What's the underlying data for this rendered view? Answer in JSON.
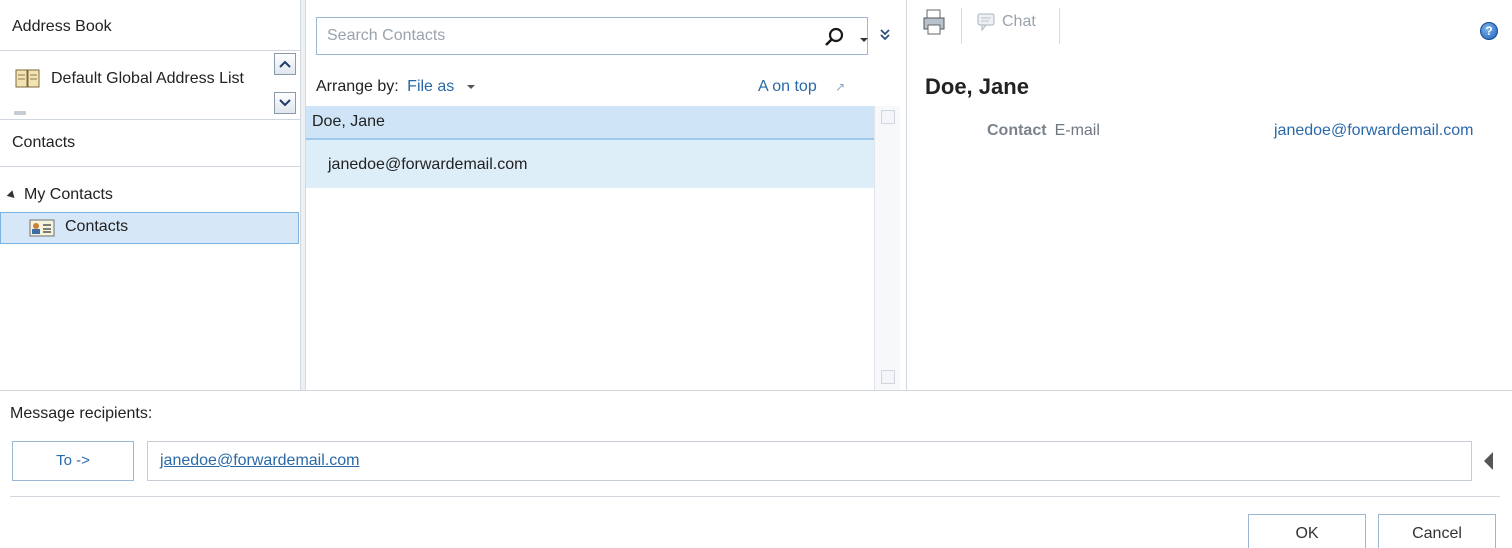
{
  "left_pane": {
    "title": "Address Book",
    "global_list_label": "Default Global Address List",
    "contacts_header": "Contacts",
    "tree_root": "My Contacts",
    "selected_folder": "Contacts"
  },
  "list_pane": {
    "search_placeholder": "Search Contacts",
    "arrange_by_label": "Arrange by:",
    "arrange_by_value": "File as",
    "sort_order": "A on top",
    "group_header": "Doe, Jane",
    "items": [
      "janedoe@forwardemail.com"
    ]
  },
  "reading_pane": {
    "chat_label": "Chat",
    "contact_name": "Doe, Jane",
    "field_section": "Contact",
    "field_label": "E-mail",
    "field_value": "janedoe@forwardemail.com"
  },
  "recipients": {
    "label": "Message recipients:",
    "to_button": "To ->",
    "to_value": "janedoe@forwardemail.com"
  },
  "buttons": {
    "ok": "OK",
    "cancel": "Cancel"
  },
  "icons": {
    "address-book": "address-book-icon",
    "contacts-folder": "contacts-folder-icon",
    "search": "search-icon",
    "expand": "double-chevron-down-icon",
    "print": "print-icon",
    "chat": "chat-bubble-icon",
    "help": "help-icon"
  },
  "colors": {
    "accent": "#2a69a8",
    "selection": "#d6e8f8"
  }
}
